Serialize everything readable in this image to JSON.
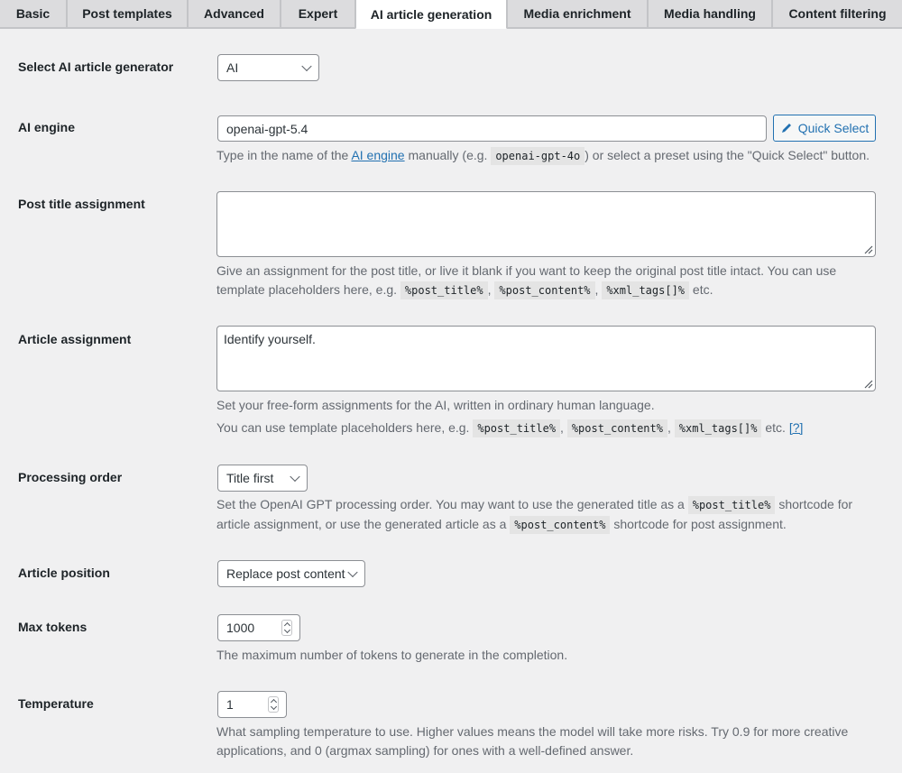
{
  "tabs": [
    {
      "label": "Basic"
    },
    {
      "label": "Post templates"
    },
    {
      "label": "Advanced"
    },
    {
      "label": "Expert"
    },
    {
      "label": "AI article generation"
    },
    {
      "label": "Media enrichment"
    },
    {
      "label": "Media handling"
    },
    {
      "label": "Content filtering"
    }
  ],
  "generator": {
    "label": "Select AI article generator",
    "value": "AI"
  },
  "engine": {
    "label": "AI engine",
    "value": "openai-gpt-5.4",
    "quick_select": "Quick Select",
    "desc_a": "Type in the name of the ",
    "desc_link": "AI engine",
    "desc_b": " manually (e.g. ",
    "desc_code": "openai-gpt-4o",
    "desc_c": ") or select a preset using the \"Quick Select\" button."
  },
  "title_assignment": {
    "label": "Post title assignment",
    "value": "",
    "desc_line1": "Give an assignment for the post title, or live it blank if you want to keep the original post title intact. You can use",
    "desc_line2": "template placeholders here, e.g.",
    "code1": "%post_title%",
    "code2": "%post_content%",
    "code3": "%xml_tags[]%",
    "tail": "etc."
  },
  "article_assignment": {
    "label": "Article assignment",
    "value": "Identify yourself.",
    "desc_line1": "Set your free-form assignments for the AI, written in ordinary human language.",
    "desc_line2": "You can use template placeholders here, e.g.",
    "code1": "%post_title%",
    "code2": "%post_content%",
    "code3": "%xml_tags[]%",
    "tail": "etc.",
    "help": "[?]"
  },
  "processing_order": {
    "label": "Processing order",
    "value": "Title first",
    "desc1a": "Set the OpenAI GPT processing order. You may want to use the generated title as a",
    "desc1_code": "%post_title%",
    "desc1b": "shortcode for",
    "desc2a": "article assignment, or use the generated article as a",
    "desc2_code": "%post_content%",
    "desc2b": "shortcode for post assignment."
  },
  "article_position": {
    "label": "Article position",
    "value": "Replace post content"
  },
  "max_tokens": {
    "label": "Max tokens",
    "value": "1000",
    "desc": "The maximum number of tokens to generate in the completion."
  },
  "temperature": {
    "label": "Temperature",
    "value": "1",
    "desc_line1": "What sampling temperature to use. Higher values means the model will take more risks. Try 0.9 for more creative",
    "desc_line2": "applications, and 0 (argmax sampling) for ones with a well-defined answer."
  },
  "icons": {
    "quick_select": "pencil-icon",
    "select": "chevron-down-icon",
    "resize": "resize-grip-icon",
    "number": "spinner-icon"
  },
  "colors": {
    "accent": "#2271b1",
    "background": "#f0f0f1",
    "text": "#1d2327",
    "muted": "#646970"
  }
}
